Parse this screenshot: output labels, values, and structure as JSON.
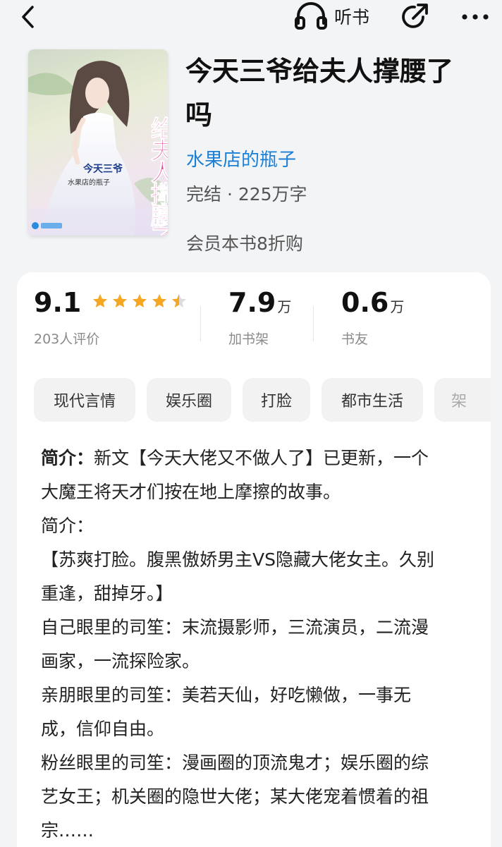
{
  "topbar": {
    "listen_label": "听书",
    "back_icon": "chevron-left-icon",
    "listen_icon": "headphones-icon",
    "share_icon": "share-icon",
    "more_icon": "more-dots-icon"
  },
  "book": {
    "title_line1": "今天三爷给夫人撑腰了",
    "title_line2": "吗",
    "author": "水果店的瓶子",
    "status": "完结 · 225万字",
    "member_offer": "会员本书8折购",
    "cover": {
      "title_text": "给夫人撑腰了吗",
      "subtitle_text": "今天三爷",
      "author_text": "水果店的瓶子"
    }
  },
  "stats": {
    "rating": "9.1",
    "rating_stars": 4.5,
    "rating_label": "203人评价",
    "shelf_value": "7.9",
    "shelf_unit": "万",
    "shelf_label": "加书架",
    "fans_value": "0.6",
    "fans_unit": "万",
    "fans_label": "书友"
  },
  "tags": [
    "现代言情",
    "娱乐圈",
    "打脸",
    "都市生活",
    "架"
  ],
  "intro": {
    "head": "简介：",
    "first_line_rest": "新文【今天大佬又不做人了】已更新，一个",
    "lines": [
      "大魔王将天才们按在地上摩擦的故事。",
      "简介：",
      "【苏爽打脸。腹黑傲娇男主VS隐藏大佬女主。久别",
      "重逢，甜掉牙。】",
      "自己眼里的司笙：末流摄影师，三流演员，二流漫",
      "画家，一流探险家。",
      "亲朋眼里的司笙：美若天仙，好吃懒做，一事无",
      "成，信仰自由。",
      "粉丝眼里的司笙：漫画圈的顶流鬼才；娱乐圈的综",
      "艺女王；机关圈的隐世大佬；某大佬宠着惯着的祖",
      "宗……"
    ]
  },
  "colors": {
    "accent": "#1b7fd6",
    "star": "#f5a623",
    "background": "#f3f4f6",
    "card": "#ffffff",
    "tag_bg": "#f2f2f2"
  }
}
